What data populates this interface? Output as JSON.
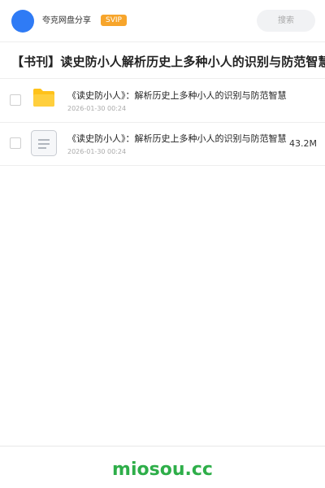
{
  "header": {
    "user_name": "夸克网盘分享",
    "badge": "SVIP",
    "search_label": "搜索"
  },
  "share": {
    "title": "【书刊】读史防小人解析历史上多种小人的识别与防范智慧"
  },
  "files": [
    {
      "icon": "folder-icon",
      "name": "《读史防小人》：解析历史上多种小人的识别与防范智慧",
      "date": "2026-01-30 00:24",
      "size": ""
    },
    {
      "icon": "document-icon",
      "name": "《读史防小人》：解析历史上多种小人的识别与防范智慧",
      "date": "2026-01-30 00:24",
      "size": "43.2M"
    }
  ],
  "footer": {
    "brand": "miosou.cc"
  },
  "colors": {
    "avatar": "#2f7bf5",
    "badge": "#f7a52b",
    "folder": "#ffc21a",
    "brand": "#2eae49"
  }
}
